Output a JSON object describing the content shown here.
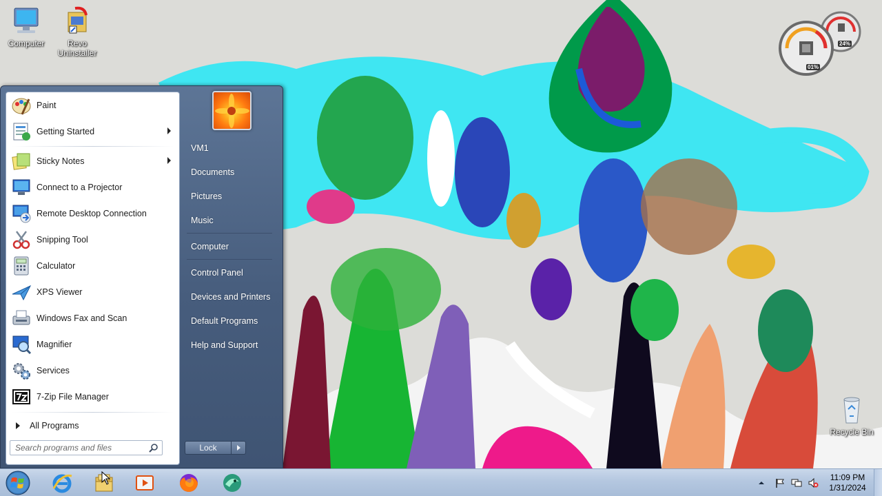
{
  "desktop": {
    "icons": [
      {
        "label": "Computer"
      },
      {
        "label": "Revo Uninstaller"
      },
      {
        "label": "Recycle Bin"
      }
    ],
    "gadget": {
      "cpu": "01%",
      "memory": "24%"
    }
  },
  "start_menu": {
    "programs": [
      {
        "label": "Paint",
        "icon": "paint-icon",
        "submenu": false
      },
      {
        "label": "Getting Started",
        "icon": "getting-started-icon",
        "submenu": true
      },
      {
        "label": "Sticky Notes",
        "icon": "sticky-notes-icon",
        "submenu": true
      },
      {
        "label": "Connect to a Projector",
        "icon": "projector-icon",
        "submenu": false
      },
      {
        "label": "Remote Desktop Connection",
        "icon": "remote-desktop-icon",
        "submenu": false
      },
      {
        "label": "Snipping Tool",
        "icon": "scissors-icon",
        "submenu": false
      },
      {
        "label": "Calculator",
        "icon": "calculator-icon",
        "submenu": false
      },
      {
        "label": "XPS Viewer",
        "icon": "xps-viewer-icon",
        "submenu": false
      },
      {
        "label": "Windows Fax and Scan",
        "icon": "fax-icon",
        "submenu": false
      },
      {
        "label": "Magnifier",
        "icon": "magnifier-icon",
        "submenu": false
      },
      {
        "label": "Services",
        "icon": "gears-icon",
        "submenu": false
      },
      {
        "label": "7-Zip File Manager",
        "icon": "7zip-icon",
        "submenu": false
      }
    ],
    "all_programs": "All Programs",
    "search_placeholder": "Search programs and files",
    "right_items": [
      "VM1",
      "Documents",
      "Pictures",
      "Music",
      "Computer",
      "Control Panel",
      "Devices and Printers",
      "Default Programs",
      "Help and Support"
    ],
    "lock_label": "Lock"
  },
  "taskbar": {
    "pinned": [
      "start-orb",
      "internet-explorer-icon",
      "file-explorer-icon",
      "media-player-icon",
      "firefox-icon",
      "app-icon"
    ],
    "clock": {
      "time": "11:09 PM",
      "date": "1/31/2024"
    }
  }
}
